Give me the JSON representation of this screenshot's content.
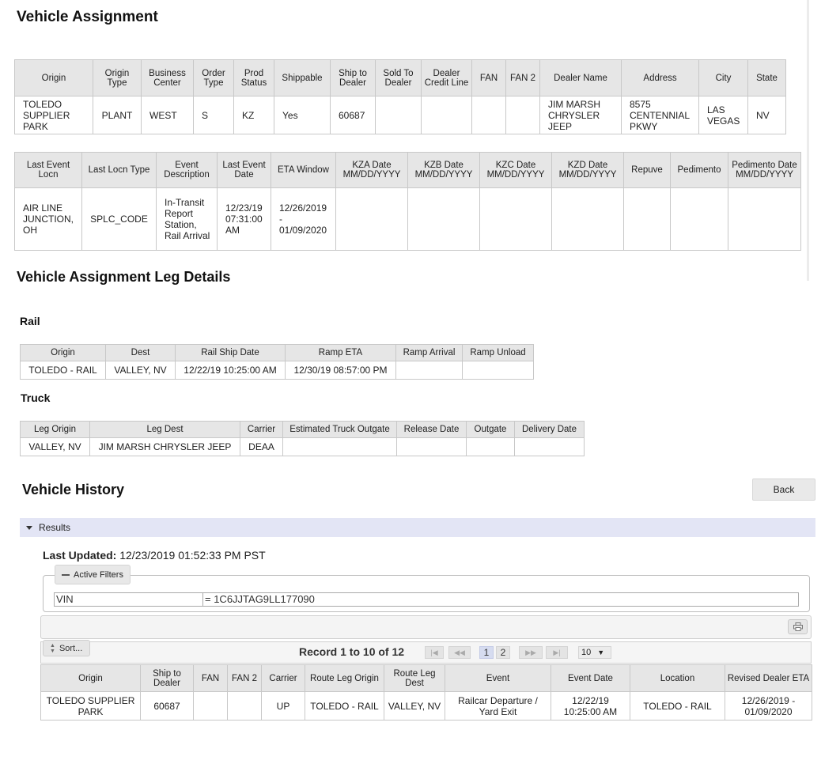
{
  "headings": {
    "vehicle_assignment": "Vehicle Assignment",
    "leg_details": "Vehicle Assignment Leg Details",
    "rail": "Rail",
    "truck": "Truck",
    "vehicle_history": "Vehicle History"
  },
  "assignment_table": {
    "columns": [
      "Origin",
      "Origin Type",
      "Business Center",
      "Order Type",
      "Prod Status",
      "Shippable",
      "Ship to Dealer",
      "Sold To Dealer",
      "Dealer Credit Line",
      "FAN",
      "FAN 2",
      "Dealer Name",
      "Address",
      "City",
      "State"
    ],
    "row": [
      "TOLEDO SUPPLIER PARK",
      "PLANT",
      "WEST",
      "S",
      "KZ",
      "Yes",
      "60687",
      "",
      "",
      "",
      "",
      "JIM MARSH CHRYSLER JEEP",
      "8575 CENTENNIAL PKWY",
      "LAS VEGAS",
      "NV"
    ]
  },
  "event_table": {
    "columns": [
      "Last Event Locn",
      "Last Locn Type",
      "Event Description",
      "Last Event Date",
      "ETA Window",
      "KZA Date MM/DD/YYYY",
      "KZB Date MM/DD/YYYY",
      "KZC Date MM/DD/YYYY",
      "KZD Date MM/DD/YYYY",
      "Repuve",
      "Pedimento",
      "Pedimento Date MM/DD/YYYY"
    ],
    "row": [
      "AIR LINE JUNCTION, OH",
      "SPLC_CODE",
      "In-Transit Report Station, Rail Arrival",
      "12/23/19 07:31:00 AM",
      "12/26/2019 - 01/09/2020",
      "",
      "",
      "",
      "",
      "",
      "",
      ""
    ]
  },
  "rail_table": {
    "columns": [
      "Origin",
      "Dest",
      "Rail Ship Date",
      "Ramp ETA",
      "Ramp Arrival",
      "Ramp Unload"
    ],
    "row": [
      "TOLEDO - RAIL",
      "VALLEY, NV",
      "12/22/19 10:25:00 AM",
      "12/30/19 08:57:00 PM",
      "",
      ""
    ]
  },
  "truck_table": {
    "columns": [
      "Leg Origin",
      "Leg Dest",
      "Carrier",
      "Estimated Truck Outgate",
      "Release Date",
      "Outgate",
      "Delivery Date"
    ],
    "row": [
      "VALLEY, NV",
      "JIM MARSH CHRYSLER JEEP",
      "DEAA",
      "",
      "",
      "",
      ""
    ]
  },
  "history": {
    "back_label": "Back",
    "results_label": "Results",
    "last_updated_label": "Last Updated:",
    "last_updated_value": "12/23/2019 01:52:33 PM PST",
    "active_filters_label": "Active Filters",
    "filter_field": "VIN",
    "filter_value": "= 1C6JJTAG9LL177090",
    "sort_label": "Sort...",
    "record_text": "Record 1 to 10 of 12",
    "pages": [
      "1",
      "2"
    ],
    "page_nav": {
      "first": "|◀",
      "prev": "◀◀",
      "next": "▶▶",
      "last": "▶|"
    },
    "page_size": "10",
    "columns": [
      "Origin",
      "Ship to Dealer",
      "FAN",
      "FAN 2",
      "Carrier",
      "Route Leg Origin",
      "Route Leg Dest",
      "Event",
      "Event Date",
      "Location",
      "Revised Dealer ETA"
    ],
    "row": [
      "TOLEDO SUPPLIER PARK",
      "60687",
      "",
      "",
      "UP",
      "TOLEDO - RAIL",
      "VALLEY, NV",
      "Railcar Departure / Yard Exit",
      "12/22/19 10:25:00 AM",
      "TOLEDO - RAIL",
      "12/26/2019 - 01/09/2020"
    ]
  },
  "icons": {
    "print": "printer-icon",
    "collapse": "triangle-down-icon",
    "minus": "minus-icon",
    "sort": "sort-arrows-icon"
  }
}
